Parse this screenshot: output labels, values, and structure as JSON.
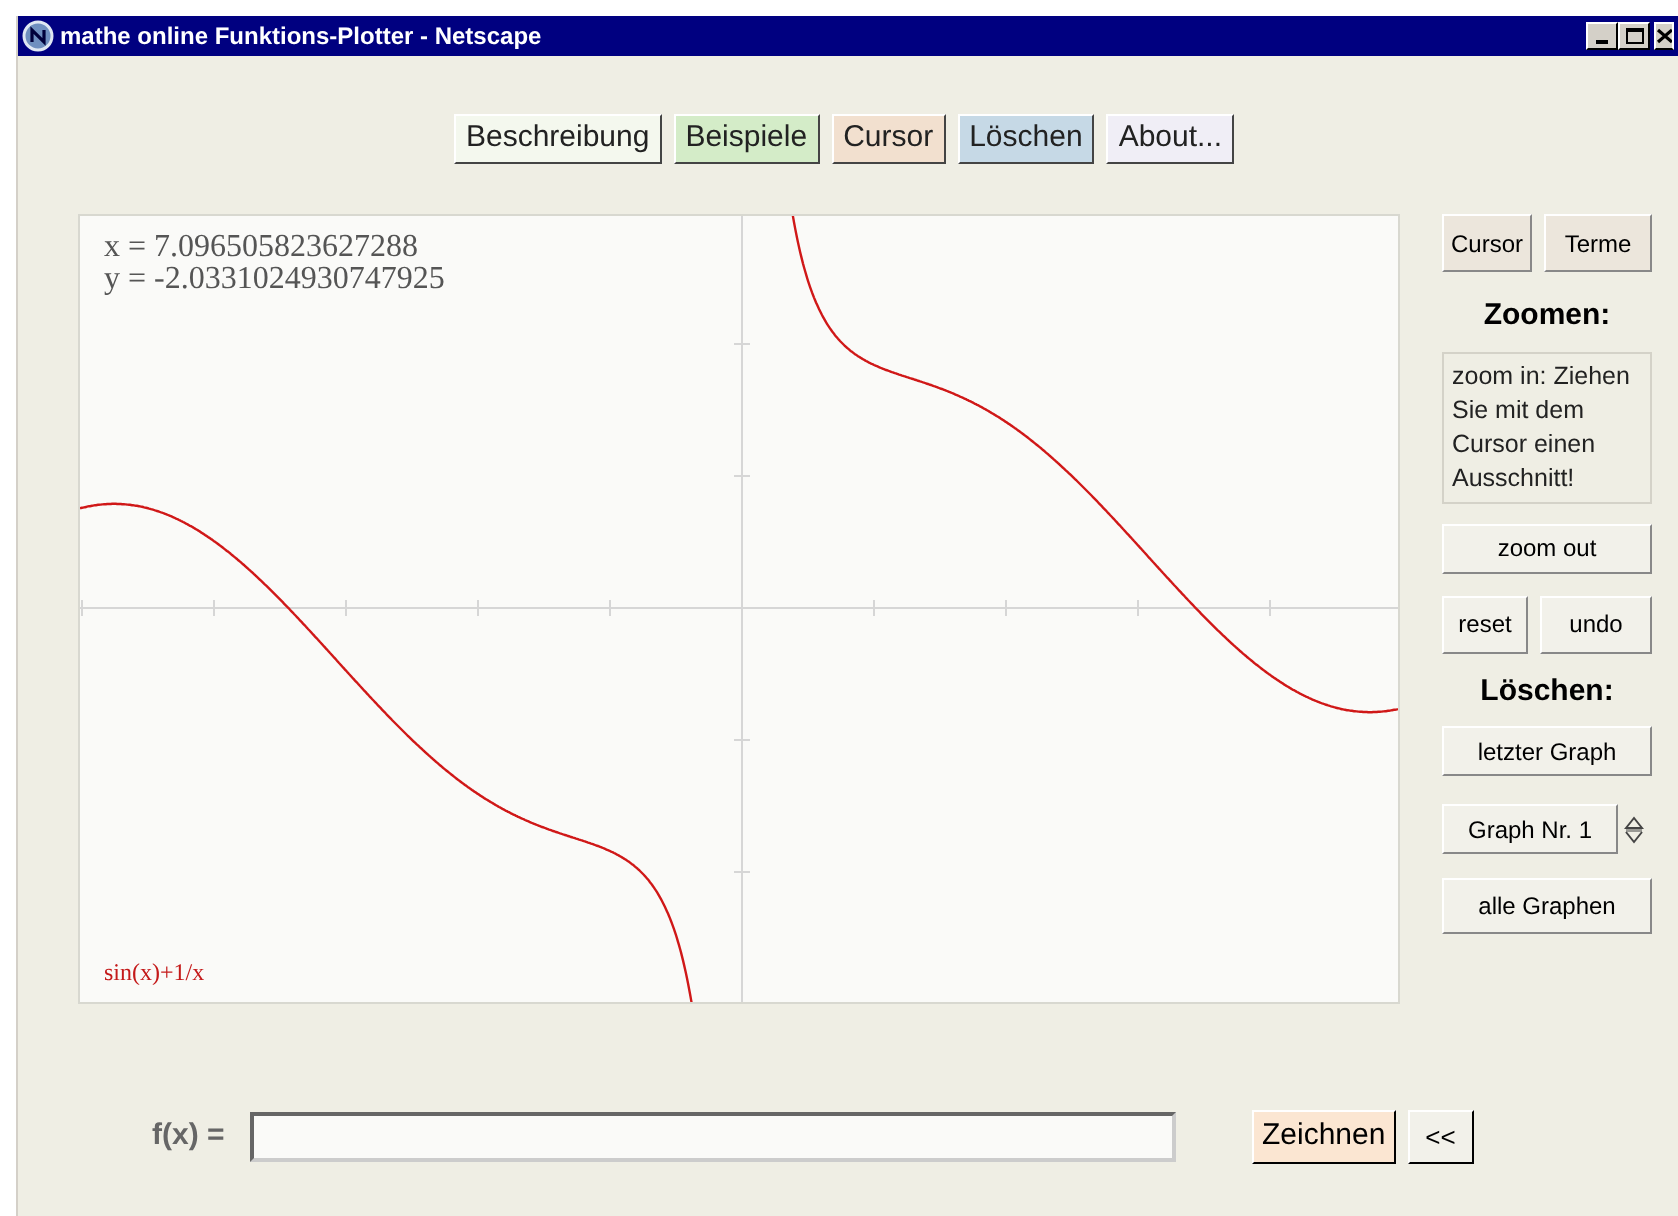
{
  "window": {
    "title": "mathe online Funktions-Plotter - Netscape"
  },
  "nav_buttons": [
    {
      "label": "Beschreibung",
      "color": "#f4f8ee"
    },
    {
      "label": "Beispiele",
      "color": "#d4ecc8"
    },
    {
      "label": "Cursor",
      "color": "#f2e0cf"
    },
    {
      "label": "Löschen",
      "color": "#c6d9e6"
    },
    {
      "label": "About...",
      "color": "#f0eef6"
    }
  ],
  "plot": {
    "cursor_readout": [
      "x = 7.096505823627288",
      "y = -2.0331024930747925"
    ],
    "graph_label": "sin(x)+1/x"
  },
  "side_panel": {
    "mode_buttons": [
      "Cursor",
      "Terme"
    ],
    "zoom_heading": "Zoomen:",
    "zoom_hint": "zoom in: Ziehen Sie mit dem Cursor einen Ausschnitt!",
    "zoom_out": "zoom out",
    "reset": "reset",
    "undo": "undo",
    "delete_heading": "Löschen:",
    "last_graph": "letzter Graph",
    "graph_select": "Graph Nr. 1",
    "all_graphs": "alle Graphen"
  },
  "formula": {
    "label": "f(x) =",
    "draw_button": "Zeichnen",
    "back_button": "<<"
  }
}
